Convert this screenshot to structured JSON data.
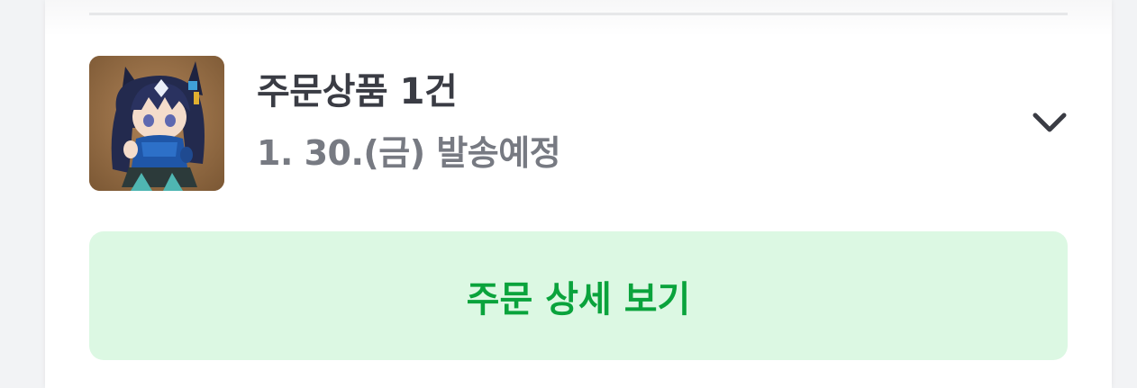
{
  "order": {
    "title": "주문상품 1건",
    "shipping_status": "1. 30.(금) 발송예정",
    "expand_icon": "chevron-down-icon",
    "thumbnail": "product-thumbnail"
  },
  "actions": {
    "detail_label": "주문 상세 보기"
  },
  "colors": {
    "accent": "#0aa33c",
    "button_bg": "#dcf8e3",
    "title": "#3a3c44",
    "subtitle": "#777a82"
  }
}
